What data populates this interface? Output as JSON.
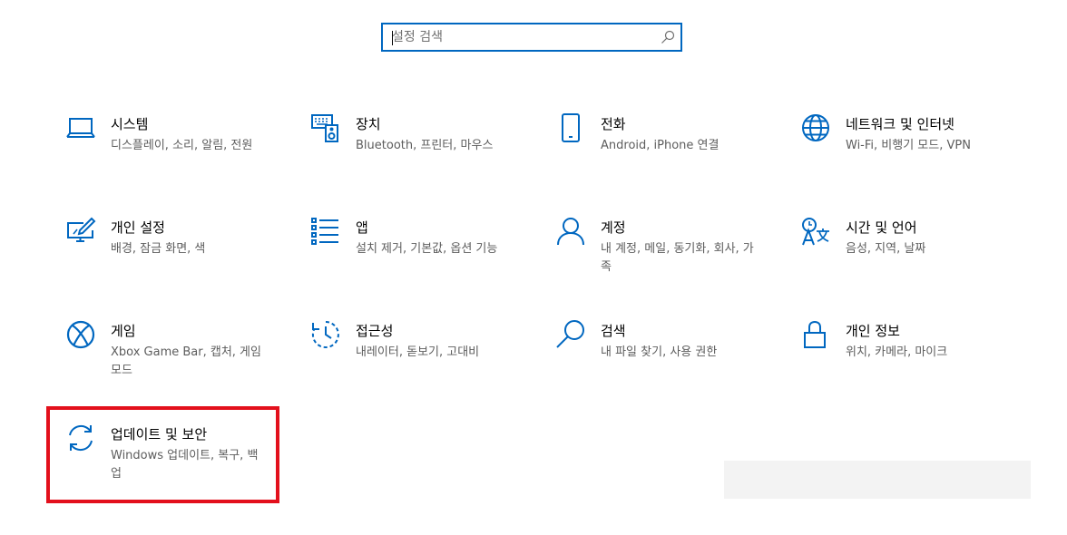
{
  "search": {
    "placeholder": "설정 검색",
    "icon": "search-icon"
  },
  "colors": {
    "accent": "#0067c0",
    "highlight": "#e3101c"
  },
  "tiles": [
    {
      "title": "시스템",
      "desc": "디스플레이, 소리, 알림, 전원",
      "icon": "laptop-icon"
    },
    {
      "title": "장치",
      "desc": "Bluetooth, 프린터, 마우스",
      "icon": "devices-icon"
    },
    {
      "title": "전화",
      "desc": "Android, iPhone 연결",
      "icon": "phone-icon"
    },
    {
      "title": "네트워크 및 인터넷",
      "desc": "Wi-Fi, 비행기 모드, VPN",
      "icon": "globe-icon"
    },
    {
      "title": "개인 설정",
      "desc": "배경, 잠금 화면, 색",
      "icon": "personalization-icon"
    },
    {
      "title": "앱",
      "desc": "설치 제거, 기본값, 옵션 기능",
      "icon": "apps-list-icon"
    },
    {
      "title": "계정",
      "desc": "내 계정, 메일, 동기화, 회사, 가족",
      "icon": "person-icon"
    },
    {
      "title": "시간 및 언어",
      "desc": "음성, 지역, 날짜",
      "icon": "time-language-icon"
    },
    {
      "title": "게임",
      "desc": "Xbox Game Bar, 캡처, 게임 모드",
      "icon": "xbox-icon"
    },
    {
      "title": "접근성",
      "desc": "내레이터, 돋보기, 고대비",
      "icon": "ease-of-access-icon"
    },
    {
      "title": "검색",
      "desc": "내 파일 찾기, 사용 권한",
      "icon": "magnifier-icon"
    },
    {
      "title": "개인 정보",
      "desc": "위치, 카메라, 마이크",
      "icon": "lock-icon"
    },
    {
      "title": "업데이트 및 보안",
      "desc": "Windows 업데이트, 복구, 백업",
      "icon": "sync-icon"
    }
  ]
}
